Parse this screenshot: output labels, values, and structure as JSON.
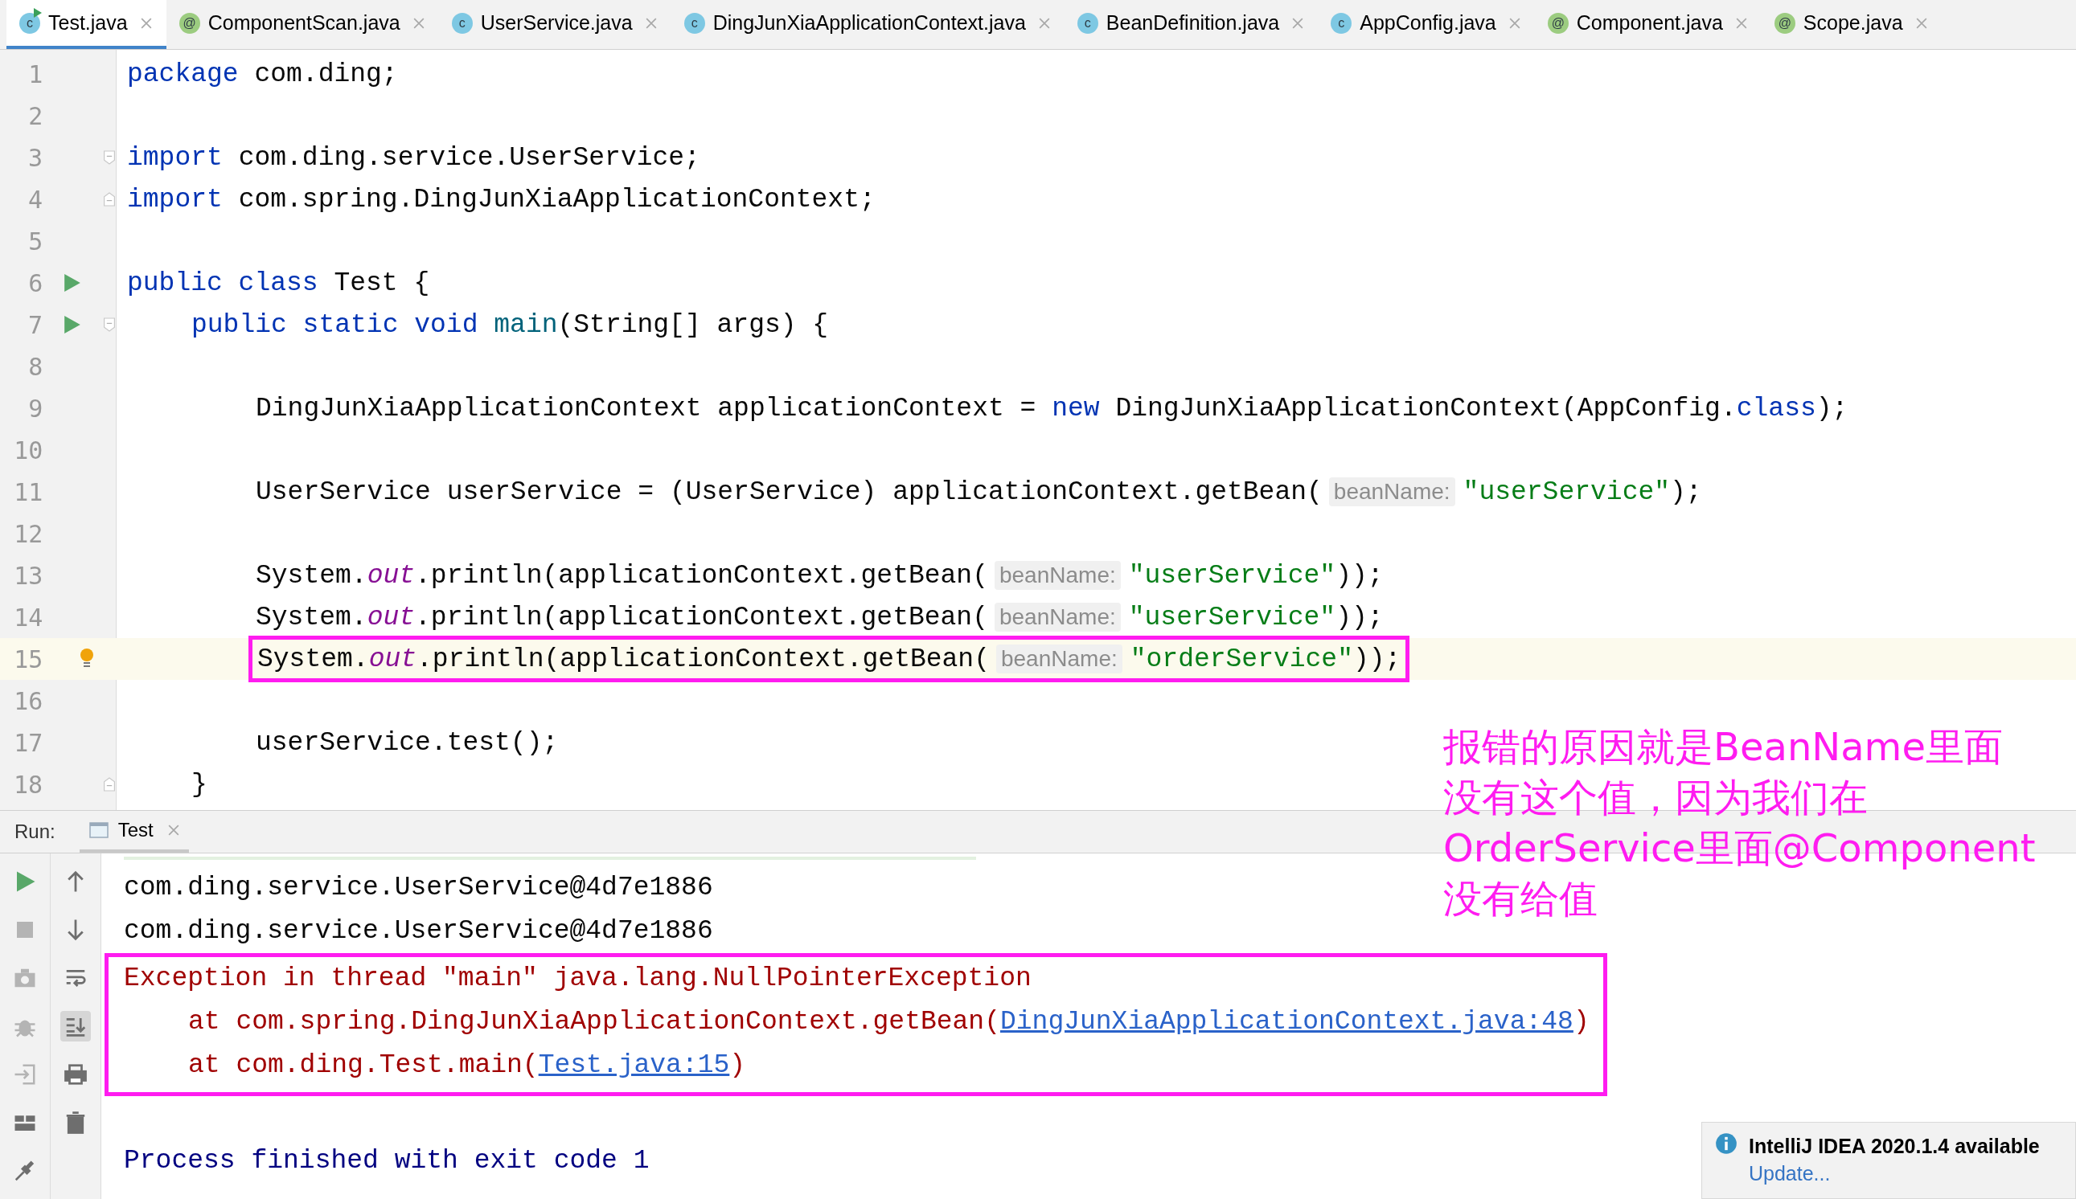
{
  "tabs": [
    {
      "label": "Test.java",
      "kind": "class",
      "glyph": "c",
      "runnable": true,
      "selected": true
    },
    {
      "label": "ComponentScan.java",
      "kind": "annotation",
      "glyph": "@",
      "runnable": false,
      "selected": false
    },
    {
      "label": "UserService.java",
      "kind": "class",
      "glyph": "c",
      "runnable": false,
      "selected": false
    },
    {
      "label": "DingJunXiaApplicationContext.java",
      "kind": "class",
      "glyph": "c",
      "runnable": false,
      "selected": false
    },
    {
      "label": "BeanDefinition.java",
      "kind": "class",
      "glyph": "c",
      "runnable": false,
      "selected": false
    },
    {
      "label": "AppConfig.java",
      "kind": "class",
      "glyph": "c",
      "runnable": false,
      "selected": false
    },
    {
      "label": "Component.java",
      "kind": "annotation",
      "glyph": "@",
      "runnable": false,
      "selected": false
    },
    {
      "label": "Scope.java",
      "kind": "annotation",
      "glyph": "@",
      "runnable": false,
      "selected": false
    }
  ],
  "editor": {
    "lines": [
      {
        "number": "1",
        "current": false,
        "boxed": false,
        "tokens": [
          {
            "text": "package",
            "kind": "keyword"
          },
          {
            "text": " com.ding;",
            "kind": "plain"
          }
        ]
      },
      {
        "number": "2",
        "current": false,
        "boxed": false
      },
      {
        "number": "3",
        "current": false,
        "boxed": false,
        "gutter_icons": [
          {
            "kind": "fold_start"
          }
        ],
        "tokens": [
          {
            "text": "import",
            "kind": "keyword"
          },
          {
            "text": " com.ding.service.UserService;",
            "kind": "plain"
          }
        ]
      },
      {
        "number": "4",
        "current": false,
        "boxed": false,
        "gutter_icons": [
          {
            "kind": "fold_end"
          }
        ],
        "tokens": [
          {
            "text": "import",
            "kind": "keyword"
          },
          {
            "text": " com.spring.DingJunXiaApplicationContext;",
            "kind": "plain"
          }
        ]
      },
      {
        "number": "5",
        "current": false,
        "boxed": false
      },
      {
        "number": "6",
        "current": false,
        "boxed": false,
        "gutter_icons": [
          {
            "kind": "run"
          }
        ],
        "tokens": [
          {
            "text": "public class",
            "kind": "keyword"
          },
          {
            "text": " Test {",
            "kind": "plain"
          }
        ],
        "children": [
          {
            "number": "7",
            "current": false,
            "boxed": false,
            "gutter_icons": [
              {
                "kind": "run"
              },
              {
                "kind": "fold_start"
              }
            ],
            "tokens": [
              {
                "text": "public static void",
                "kind": "keyword"
              },
              {
                "text": " main",
                "kind": "declaration"
              },
              {
                "text": "(String[] args) {",
                "kind": "plain"
              }
            ],
            "children": [
              {
                "number": "8",
                "current": false,
                "boxed": false
              },
              {
                "number": "9",
                "current": false,
                "boxed": false,
                "tokens": [
                  {
                    "text": "DingJunXiaApplicationContext applicationContext = ",
                    "kind": "plain"
                  },
                  {
                    "text": "new",
                    "kind": "keyword"
                  },
                  {
                    "text": " DingJunXiaApplicationContext(AppConfig.",
                    "kind": "plain"
                  },
                  {
                    "text": "class",
                    "kind": "keyword"
                  },
                  {
                    "text": ");",
                    "kind": "plain"
                  }
                ]
              },
              {
                "number": "10",
                "current": false,
                "boxed": false
              },
              {
                "number": "11",
                "current": false,
                "boxed": false,
                "tokens": [
                  {
                    "text": "UserService userService = (UserService) applicationContext.getBean(",
                    "kind": "plain"
                  },
                  {
                    "text": "beanName:",
                    "kind": "hint"
                  },
                  {
                    "text": "\"userService\"",
                    "kind": "string"
                  },
                  {
                    "text": ");",
                    "kind": "plain"
                  }
                ]
              },
              {
                "number": "12",
                "current": false,
                "boxed": false
              },
              {
                "number": "13",
                "current": false,
                "boxed": false,
                "tokens": [
                  {
                    "text": "System.",
                    "kind": "plain"
                  },
                  {
                    "text": "out",
                    "kind": "field"
                  },
                  {
                    "text": ".println(applicationContext.getBean(",
                    "kind": "plain"
                  },
                  {
                    "text": "beanName:",
                    "kind": "hint"
                  },
                  {
                    "text": "\"userService\"",
                    "kind": "string"
                  },
                  {
                    "text": "));",
                    "kind": "plain"
                  }
                ]
              },
              {
                "number": "14",
                "current": false,
                "boxed": false,
                "tokens": [
                  {
                    "text": "System.",
                    "kind": "plain"
                  },
                  {
                    "text": "out",
                    "kind": "field"
                  },
                  {
                    "text": ".println(applicationContext.getBean(",
                    "kind": "plain"
                  },
                  {
                    "text": "beanName:",
                    "kind": "hint"
                  },
                  {
                    "text": "\"userService\"",
                    "kind": "string"
                  },
                  {
                    "text": "));",
                    "kind": "plain"
                  }
                ]
              },
              {
                "number": "15",
                "current": true,
                "boxed": true,
                "gutter_icons": [
                  {
                    "kind": "bulb"
                  }
                ],
                "tokens": [
                  {
                    "text": "System.",
                    "kind": "plain"
                  },
                  {
                    "text": "out",
                    "kind": "field"
                  },
                  {
                    "text": ".println(applicationContext.getBean(",
                    "kind": "plain"
                  },
                  {
                    "text": "beanName:",
                    "kind": "hint"
                  },
                  {
                    "text": "\"orderService\"",
                    "kind": "string"
                  },
                  {
                    "text": "));",
                    "kind": "plain"
                  }
                ]
              },
              {
                "number": "16",
                "current": false,
                "boxed": false
              },
              {
                "number": "17",
                "current": false,
                "boxed": false,
                "tokens": [
                  {
                    "text": "userService.test();",
                    "kind": "plain"
                  }
                ]
              }
            ]
          },
          {
            "number": "18",
            "current": false,
            "boxed": false,
            "gutter_icons": [
              {
                "kind": "fold_end"
              }
            ],
            "tokens": [
              {
                "text": "}",
                "kind": "plain"
              }
            ]
          }
        ]
      }
    ]
  },
  "annotation": "报错的原因就是BeanName里面没有这个值，因为我们在OrderService里面@Component没有给值",
  "run": {
    "label": "Run:",
    "tab": "Test",
    "toolbar_left": [
      {
        "kind": "run",
        "disabled": false
      },
      {
        "kind": "stop",
        "disabled": true
      },
      {
        "kind": "camera",
        "disabled": true
      },
      {
        "kind": "debug",
        "disabled": true
      },
      {
        "kind": "login",
        "disabled": true
      },
      {
        "kind": "layout",
        "disabled": false
      },
      {
        "kind": "pin",
        "disabled": false
      }
    ],
    "toolbar_right": [
      {
        "kind": "up",
        "selected": false
      },
      {
        "kind": "down",
        "selected": false
      },
      {
        "kind": "wrap",
        "selected": false
      },
      {
        "kind": "scroll",
        "selected": true
      },
      {
        "kind": "print",
        "selected": false
      },
      {
        "kind": "trash",
        "selected": false
      }
    ],
    "output": [
      "com.ding.service.UserService@4d7e1886",
      "com.ding.service.UserService@4d7e1886"
    ],
    "exception": {
      "message": "Exception in thread \"main\" java.lang.NullPointerException",
      "frames": [
        {
          "prefix": "at com.spring.DingJunXiaApplicationContext.getBean(",
          "link": "DingJunXiaApplicationContext.java:48",
          "suffix": ")"
        },
        {
          "prefix": "at com.ding.Test.main(",
          "link": "Test.java:15",
          "suffix": ")"
        }
      ]
    },
    "exit": "Process finished with exit code 1"
  },
  "notification": {
    "title": "IntelliJ IDEA 2020.1.4 available",
    "action": "Update..."
  }
}
